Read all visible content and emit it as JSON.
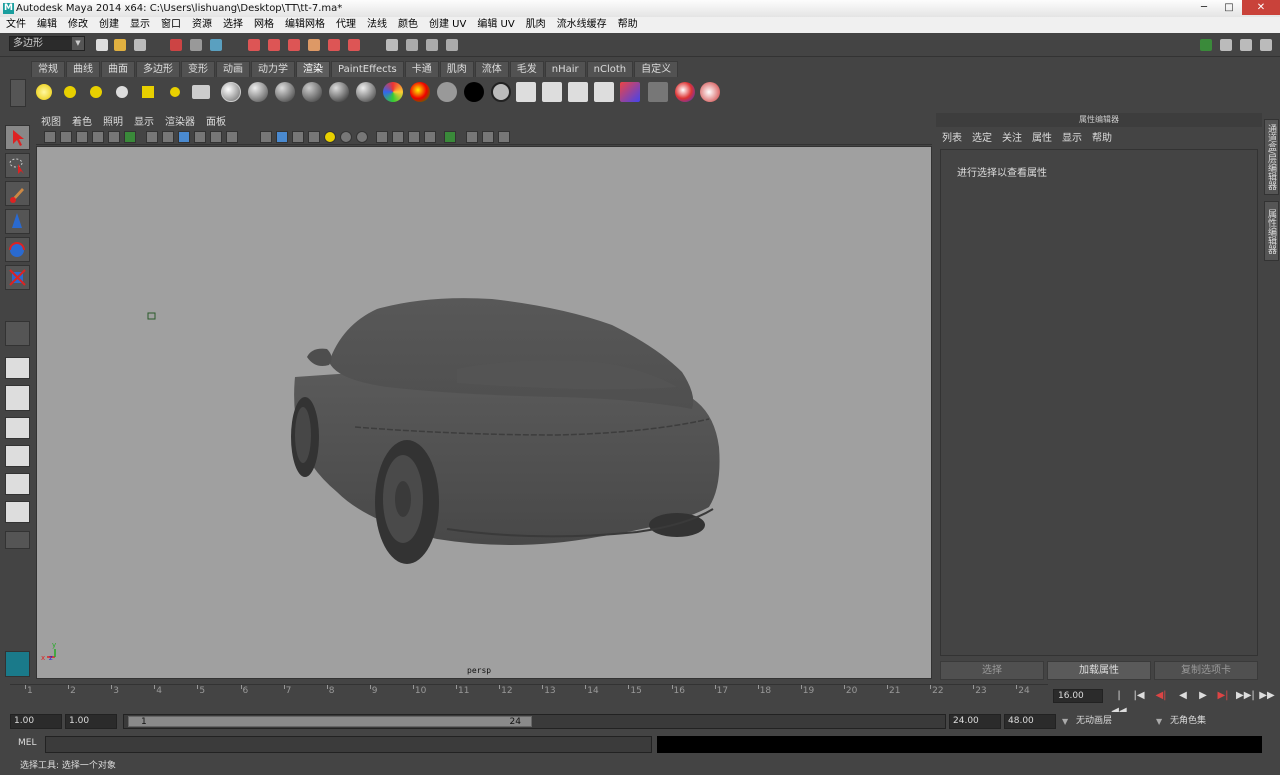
{
  "window": {
    "title": "Autodesk Maya 2014 x64: C:\\Users\\lishuang\\Desktop\\TT\\tt-7.ma*",
    "logo": "M",
    "minimize": "─",
    "maximize": "□",
    "close": "✕"
  },
  "menubar": [
    "文件",
    "编辑",
    "修改",
    "创建",
    "显示",
    "窗口",
    "资源",
    "选择",
    "网格",
    "编辑网格",
    "代理",
    "法线",
    "颜色",
    "创建 UV",
    "编辑 UV",
    "肌肉",
    "流水线缓存",
    "帮助"
  ],
  "status_line": {
    "mode": "多边形",
    "dropdown_icon": "▼"
  },
  "shelf": {
    "tabs": [
      "常规",
      "曲线",
      "曲面",
      "多边形",
      "变形",
      "动画",
      "动力学",
      "渲染",
      "PaintEffects",
      "卡通",
      "肌肉",
      "流体",
      "毛发",
      "nHair",
      "nCloth",
      "自定义"
    ],
    "active_tab": "渲染"
  },
  "viewport": {
    "menu": [
      "视图",
      "着色",
      "照明",
      "显示",
      "渲染器",
      "面板"
    ],
    "camera_label": "persp",
    "axis_x": "x",
    "axis_y": "y",
    "axis_z": "z"
  },
  "attribute_editor": {
    "title": "属性编辑器",
    "menu": [
      "列表",
      "选定",
      "关注",
      "属性",
      "显示",
      "帮助"
    ],
    "hint": "进行选择以查看属性",
    "buttons": {
      "select": "选择",
      "load": "加载属性",
      "copy_tab": "复制选项卡"
    }
  },
  "side_tabs": [
    "通道盒/层编辑器",
    "属性编辑器"
  ],
  "time_slider": {
    "ticks": [
      "1",
      "2",
      "3",
      "4",
      "5",
      "6",
      "7",
      "8",
      "9",
      "10",
      "11",
      "12",
      "13",
      "14",
      "15",
      "16",
      "17",
      "18",
      "19",
      "20",
      "21",
      "22",
      "23",
      "24"
    ],
    "current_frame": "16.00",
    "controls": [
      "|◀◀",
      "|◀",
      "◀|",
      "◀",
      "▶",
      "▶|",
      "▶▶|",
      "▶▶"
    ]
  },
  "range_slider": {
    "start": "1.00",
    "playback_start": "1.00",
    "thumb_start": "1",
    "thumb_end": "24",
    "playback_end": "24.00",
    "end": "48.00",
    "anim_layer": "无动画层",
    "char_set": "无角色集"
  },
  "command_line": {
    "label": "MEL"
  },
  "help_line": {
    "text": "选择工具: 选择一个对象"
  },
  "colors": {
    "viewport_bg": "#a0a0a0",
    "ui_bg": "#444444",
    "accent_teal": "#1a9e9e"
  }
}
